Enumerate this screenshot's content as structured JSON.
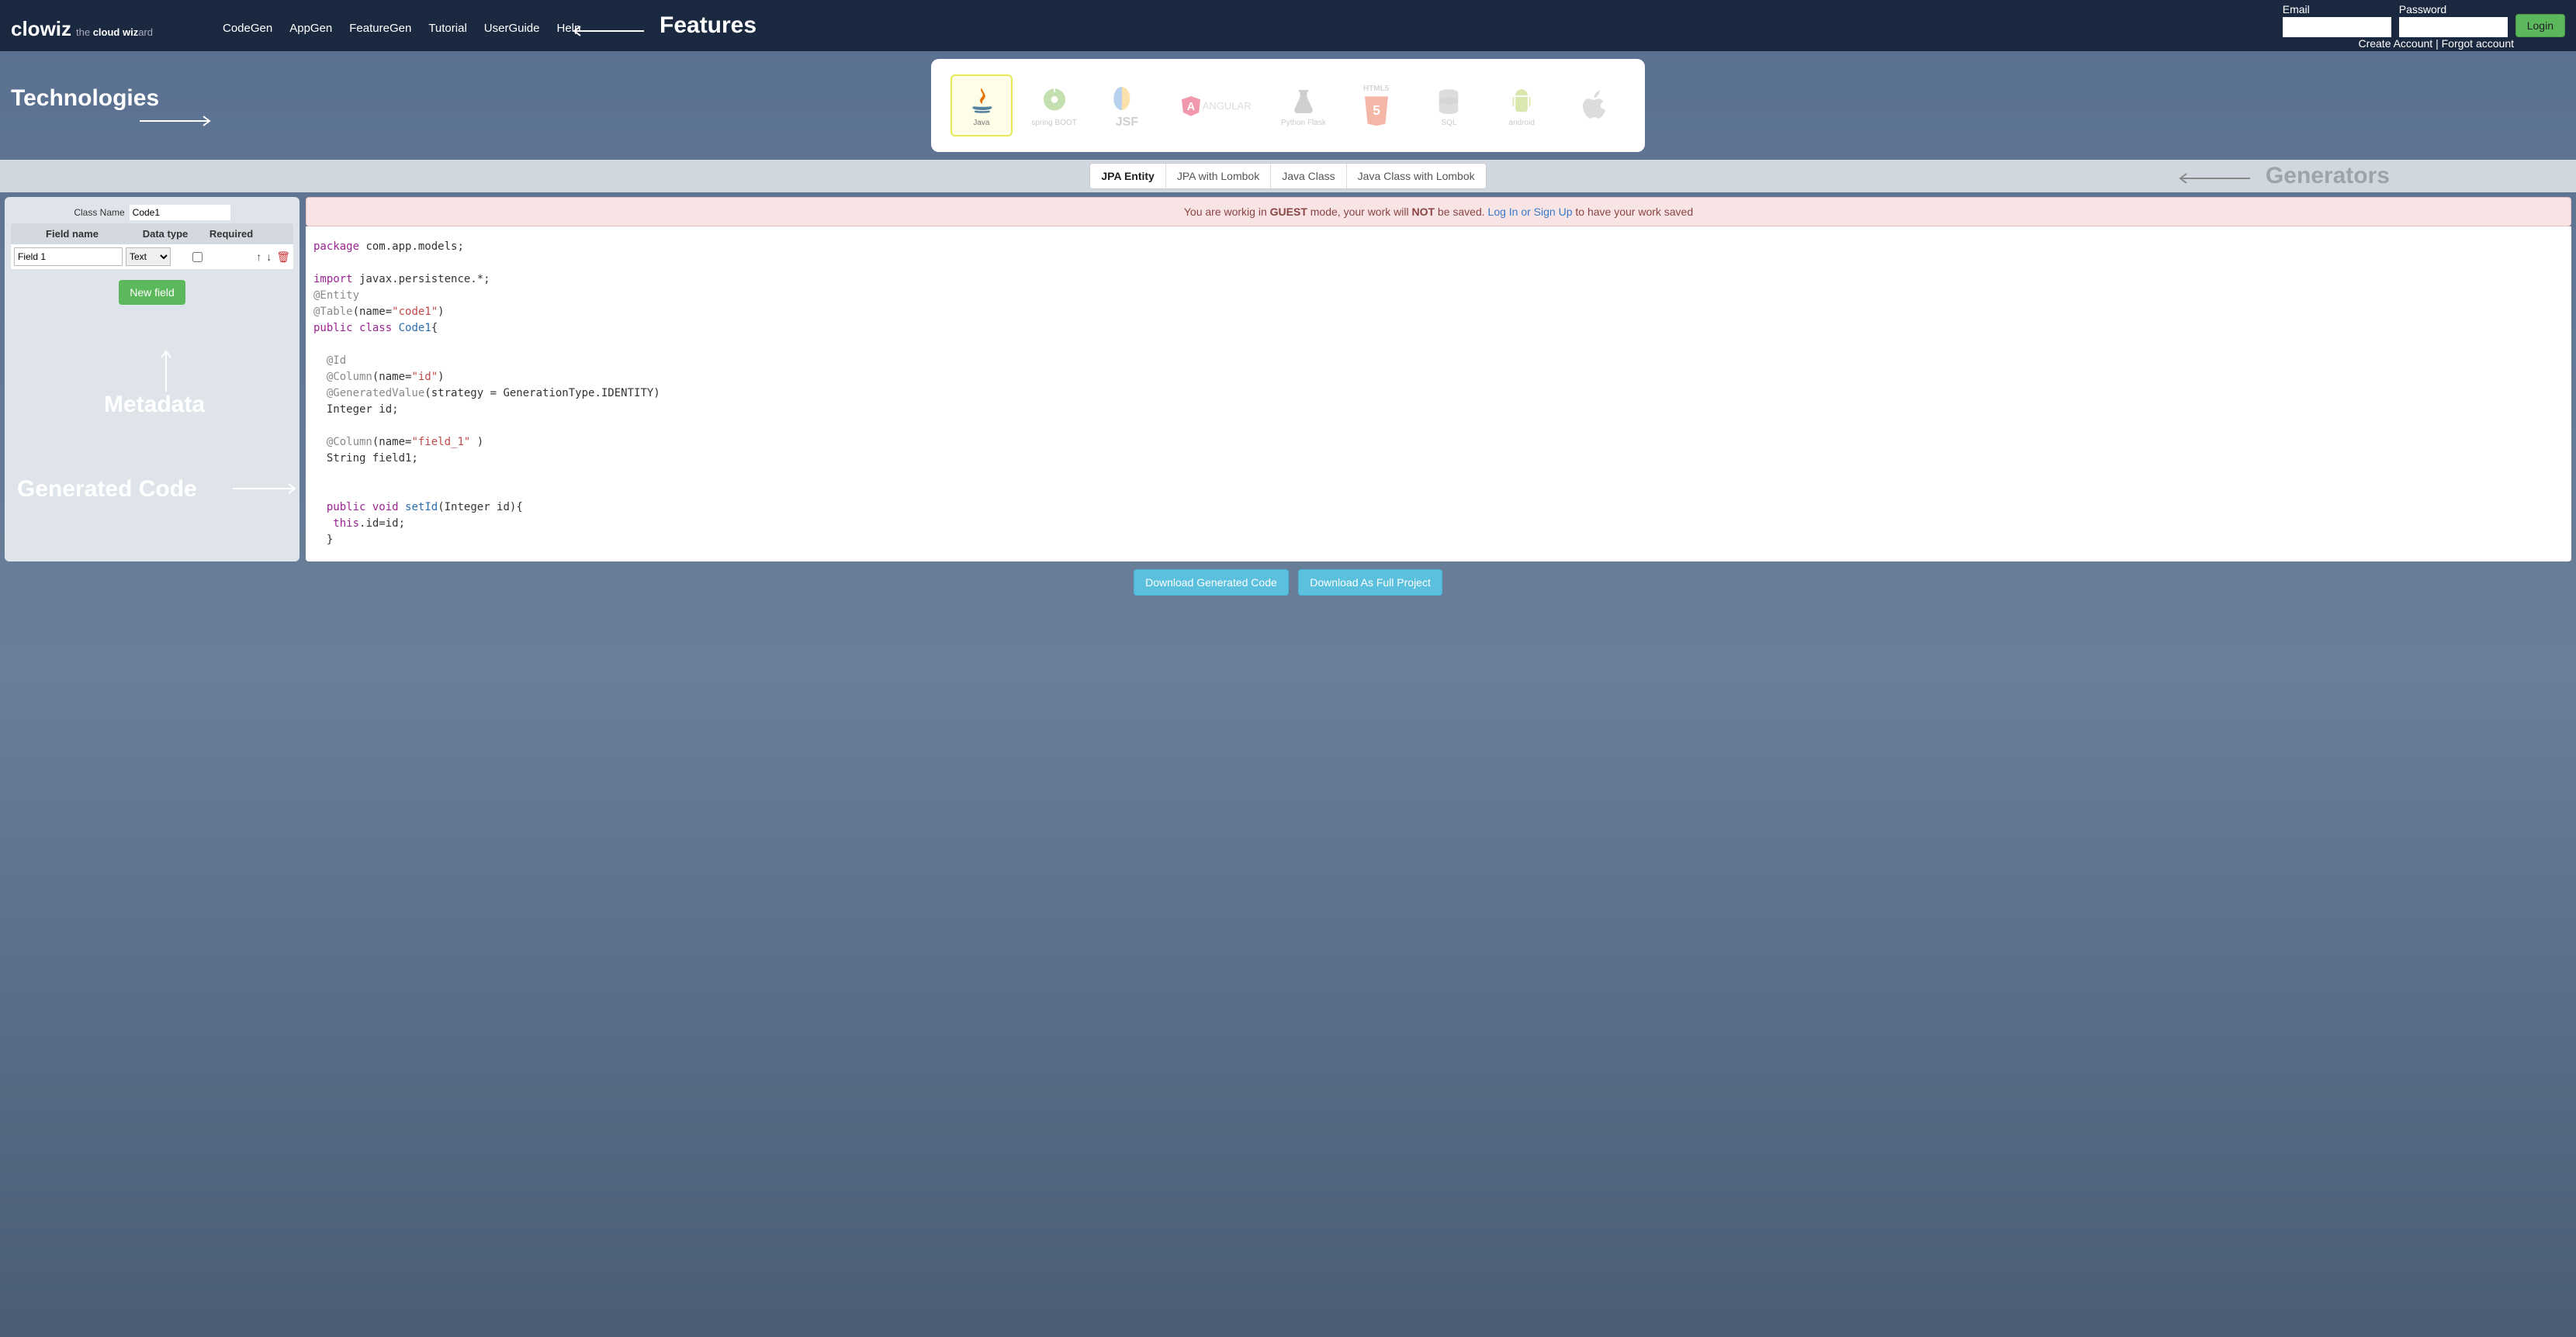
{
  "header": {
    "logo_main": "clowiz",
    "logo_tag_prefix": "the ",
    "logo_tag_bold": "cloud wiz",
    "logo_tag_suffix": "ard",
    "nav": [
      "CodeGen",
      "AppGen",
      "FeatureGen",
      "Tutorial",
      "UserGuide",
      "Help"
    ],
    "features_label": "Features",
    "email_label": "Email",
    "password_label": "Password",
    "login_btn": "Login",
    "create_account": "Create Account",
    "forgot_account": "Forgot account",
    "link_sep": " | "
  },
  "tech": {
    "label": "Technologies",
    "items": [
      {
        "name": "Java",
        "active": true
      },
      {
        "name": "spring BOOT"
      },
      {
        "name": "JSF"
      },
      {
        "name": "ANGULAR"
      },
      {
        "name": "Python Flask"
      },
      {
        "name": "HTML5"
      },
      {
        "name": "SQL"
      },
      {
        "name": "android"
      },
      {
        "name": "iOS"
      }
    ]
  },
  "generators": {
    "label": "Generators",
    "tabs": [
      "JPA Entity",
      "JPA with Lombok",
      "Java Class",
      "Java Class with Lombok"
    ],
    "active": "JPA Entity"
  },
  "meta": {
    "class_name_label": "Class Name",
    "class_name_value": "Code1",
    "columns": {
      "c1": "Field name",
      "c2": "Data type",
      "c3": "Required"
    },
    "rows": [
      {
        "name": "Field 1",
        "type": "Text",
        "required": false
      }
    ],
    "new_field_btn": "New field",
    "annotation": "Metadata"
  },
  "alert": {
    "prefix": "You are workig in ",
    "guest": "GUEST",
    "mid1": " mode, your work will ",
    "not": "NOT",
    "mid2": " be saved. ",
    "link": "Log In or Sign Up",
    "suffix": " to have your work saved"
  },
  "code": {
    "annotation": "Generated Code"
  },
  "download": {
    "btn1": "Download Generated Code",
    "btn2": "Download As Full Project"
  }
}
